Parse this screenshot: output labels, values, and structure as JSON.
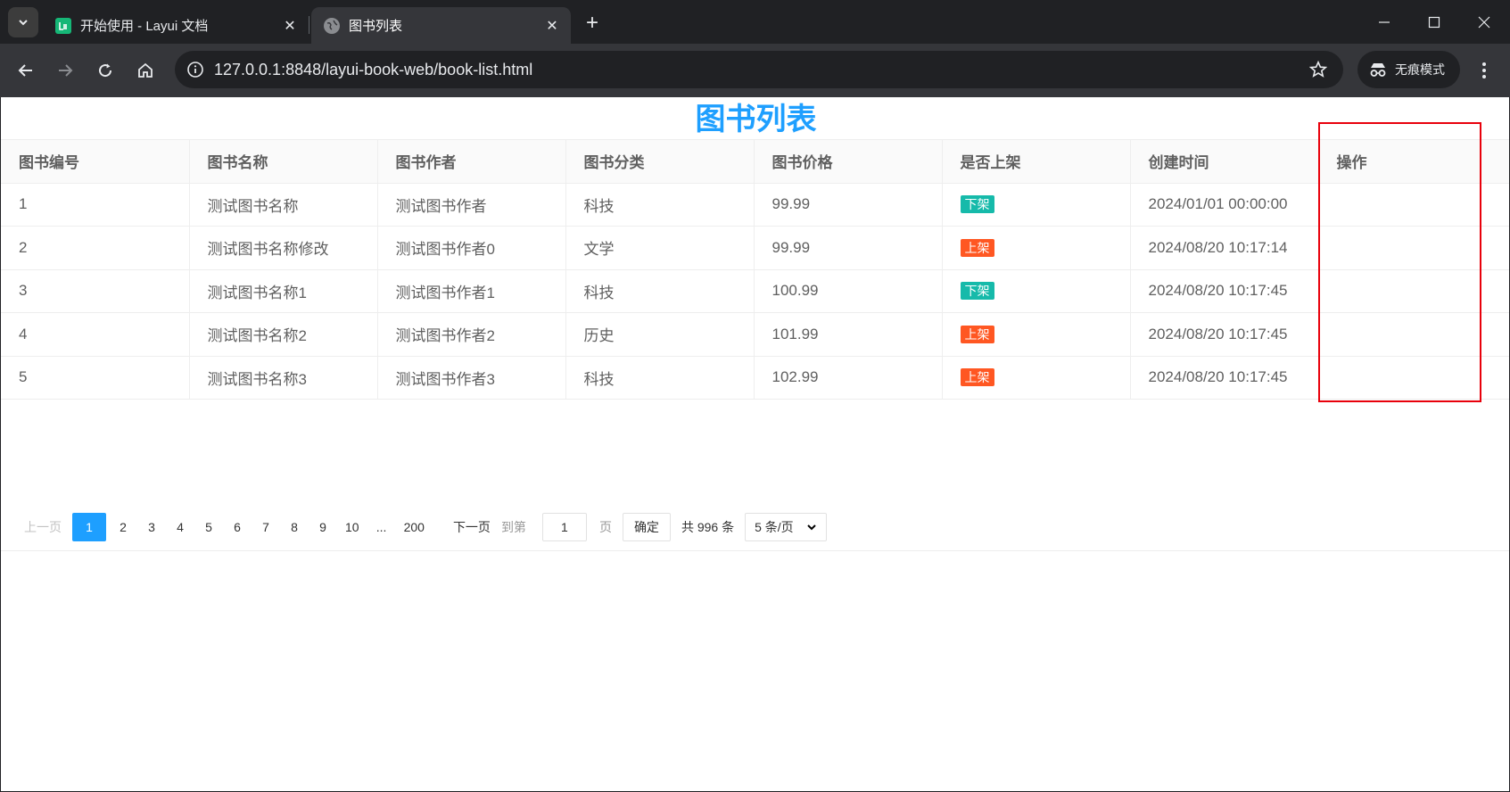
{
  "browser": {
    "tabs": [
      {
        "title": "开始使用 - Layui 文档",
        "favicon": "layui-logo-icon"
      },
      {
        "title": "图书列表",
        "favicon": "globe-icon"
      }
    ],
    "url": "127.0.0.1:8848/layui-book-web/book-list.html",
    "incognito_label": "无痕模式",
    "new_tab": "+",
    "close_glyph": "✕"
  },
  "page": {
    "title": "图书列表",
    "title_color": "#1e9fff"
  },
  "table": {
    "headers": [
      "图书编号",
      "图书名称",
      "图书作者",
      "图书分类",
      "图书价格",
      "是否上架",
      "创建时间",
      "操作"
    ],
    "rows": [
      {
        "id": "1",
        "name": "测试图书名称",
        "author": "测试图书作者",
        "category": "科技",
        "price": "99.99",
        "status": "下架",
        "status_color": "#16baaa",
        "created": "2024/01/01 00:00:00"
      },
      {
        "id": "2",
        "name": "测试图书名称修改",
        "author": "测试图书作者0",
        "category": "文学",
        "price": "99.99",
        "status": "上架",
        "status_color": "#ff5722",
        "created": "2024/08/20 10:17:14"
      },
      {
        "id": "3",
        "name": "测试图书名称1",
        "author": "测试图书作者1",
        "category": "科技",
        "price": "100.99",
        "status": "下架",
        "status_color": "#16baaa",
        "created": "2024/08/20 10:17:45"
      },
      {
        "id": "4",
        "name": "测试图书名称2",
        "author": "测试图书作者2",
        "category": "历史",
        "price": "101.99",
        "status": "上架",
        "status_color": "#ff5722",
        "created": "2024/08/20 10:17:45"
      },
      {
        "id": "5",
        "name": "测试图书名称3",
        "author": "测试图书作者3",
        "category": "科技",
        "price": "102.99",
        "status": "上架",
        "status_color": "#ff5722",
        "created": "2024/08/20 10:17:45"
      }
    ]
  },
  "pagination": {
    "prev": "上一页",
    "pages": [
      "1",
      "2",
      "3",
      "4",
      "5",
      "6",
      "7",
      "8",
      "9",
      "10"
    ],
    "ellipsis": "...",
    "last_page": "200",
    "next": "下一页",
    "goto_label": "到第",
    "goto_value": "1",
    "page_unit": "页",
    "confirm": "确定",
    "total": "共 996 条",
    "limit": "5 条/页"
  },
  "highlight_color": "#e8000b"
}
